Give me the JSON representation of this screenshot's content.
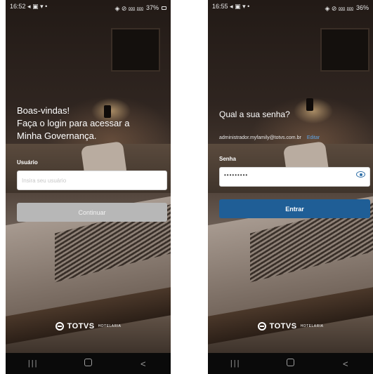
{
  "screens": [
    {
      "status": {
        "time": "16:52",
        "notif_icons": "◂ ▣ ▾ •",
        "right_icons": "◈ ⊘ ⅏ ⅏",
        "battery": "37%"
      },
      "welcome_lines": [
        "Boas-vindas!",
        "Faça o login para acessar a",
        "Minha Governança."
      ],
      "username_label": "Usuário",
      "username_placeholder": "Insira seu usuário",
      "continue_label": "Continuar"
    },
    {
      "status": {
        "time": "16:55",
        "notif_icons": "◂ ▣ ▾ •",
        "right_icons": "◈ ⊘ ⅏ ⅏",
        "battery": "36%"
      },
      "question": "Qual a sua senha?",
      "email": "administrador.myfamily@totvs.com.br",
      "edit_label": "Editar",
      "password_label": "Senha",
      "password_masked": "•••••••••",
      "enter_label": "Entrar"
    }
  ],
  "brand": {
    "name": "TOTVS",
    "sub": "HOTELARIA"
  },
  "nav": {
    "recent": "|||",
    "back": "<"
  },
  "colors": {
    "primary": "#1f5e96",
    "disabled": "#b7b7b7",
    "link": "#5fa5e6",
    "icon": "#2f6fa8"
  }
}
